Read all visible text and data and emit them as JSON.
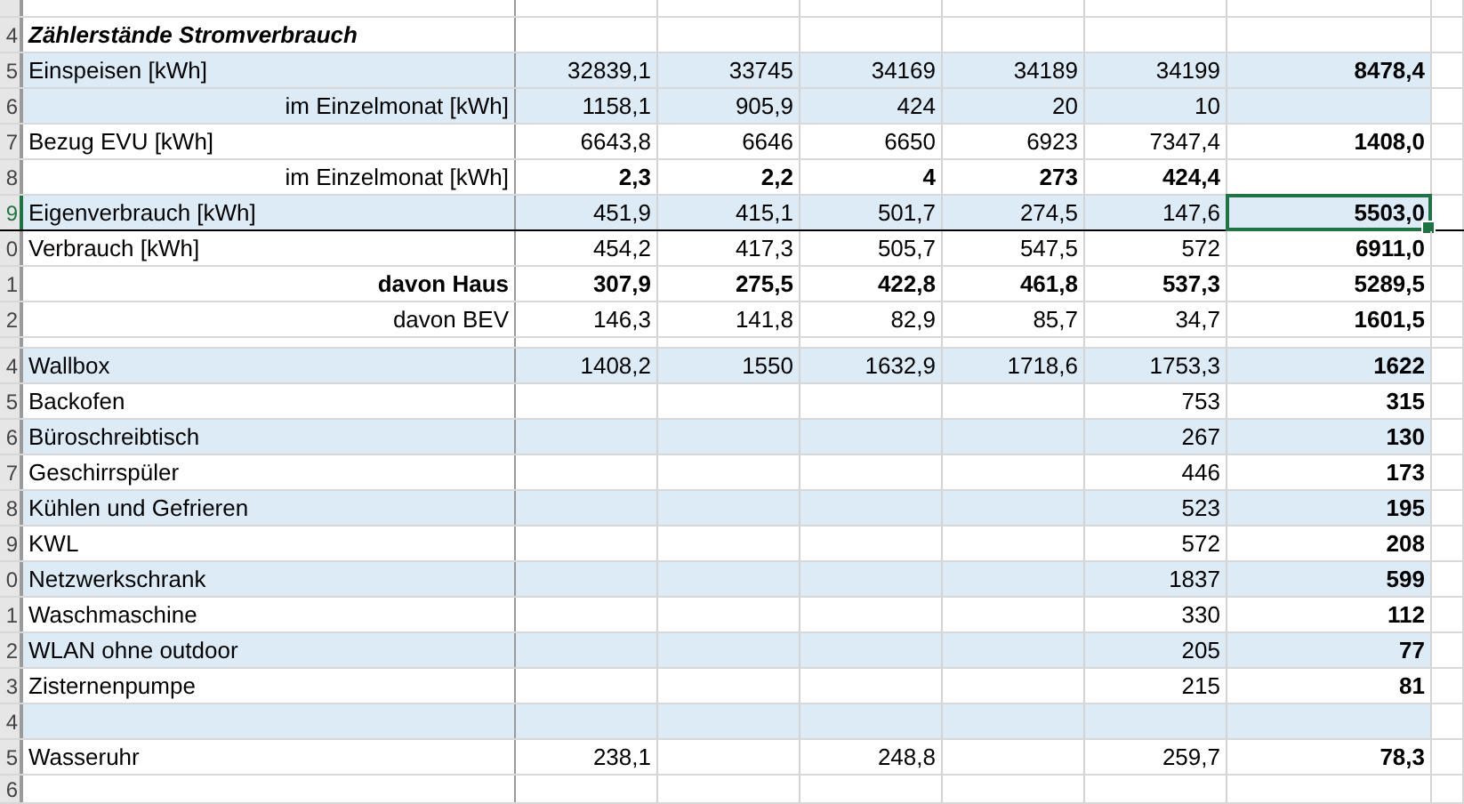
{
  "rows": [
    {
      "kind": "partial"
    },
    {
      "kind": "title",
      "header": "4",
      "label": "Zählerstände Stromverbrauch",
      "shaded": false,
      "selected": false,
      "bottom_border": false
    },
    {
      "kind": "item",
      "header": "5",
      "label": "Einspeisen [kWh]",
      "shaded": true,
      "column_2": "32839,1",
      "column_3": "33745",
      "column_4": "34169",
      "column_5": "34189",
      "column_6": "34199",
      "column_7": "8478,4",
      "values_bold": false,
      "selected": false,
      "bottom_border": false
    },
    {
      "kind": "sub",
      "header": "6",
      "label": "im Einzelmonat [kWh]",
      "shaded": true,
      "column_2": "1158,1",
      "column_3": "905,9",
      "column_4": "424",
      "column_5": "20",
      "column_6": "10",
      "values_bold": false,
      "selected": false,
      "bottom_border": false
    },
    {
      "kind": "item",
      "header": "7",
      "label": "Bezug EVU [kWh]",
      "shaded": false,
      "column_2": "6643,8",
      "column_3": "6646",
      "column_4": "6650",
      "column_5": "6923",
      "column_6": "7347,4",
      "column_7": "1408,0",
      "values_bold": false,
      "selected": false,
      "bottom_border": false
    },
    {
      "kind": "sub",
      "header": "8",
      "label": "im Einzelmonat [kWh]",
      "shaded": false,
      "column_2": "2,3",
      "column_3": "2,2",
      "column_4": "4",
      "column_5": "273",
      "column_6": "424,4",
      "values_bold": true,
      "selected": false,
      "bottom_border": false
    },
    {
      "kind": "item",
      "header": "9",
      "label": "Eigenverbrauch [kWh]",
      "shaded": true,
      "column_2": "451,9",
      "column_3": "415,1",
      "column_4": "501,7",
      "column_5": "274,5",
      "column_6": "147,6",
      "column_7": "5503,0",
      "values_bold": false,
      "selected": true,
      "bottom_border": true
    },
    {
      "kind": "item",
      "header": "0",
      "label": "Verbrauch [kWh]",
      "shaded": false,
      "column_2": "454,2",
      "column_3": "417,3",
      "column_4": "505,7",
      "column_5": "547,5",
      "column_6": "572",
      "column_7": "6911,0",
      "values_bold": false,
      "selected": false,
      "bottom_border": false
    },
    {
      "kind": "sub_bold",
      "header": "1",
      "label": "davon Haus",
      "shaded": false,
      "column_2": "307,9",
      "column_3": "275,5",
      "column_4": "422,8",
      "column_5": "461,8",
      "column_6": "537,3",
      "column_7": "5289,5",
      "values_bold": true,
      "selected": false,
      "bottom_border": false
    },
    {
      "kind": "sub",
      "header": "2",
      "label": "davon BEV",
      "shaded": false,
      "column_2": "146,3",
      "column_3": "141,8",
      "column_4": "82,9",
      "column_5": "85,7",
      "column_6": "34,7",
      "column_7": "1601,5",
      "values_bold": false,
      "selected": false,
      "bottom_border": false
    },
    {
      "kind": "spacer"
    },
    {
      "kind": "item",
      "header": "4",
      "label": "Wallbox",
      "shaded": true,
      "column_2": "1408,2",
      "column_3": "1550",
      "column_4": "1632,9",
      "column_5": "1718,6",
      "column_6": "1753,3",
      "column_7": "1622",
      "values_bold": false,
      "selected": false,
      "bottom_border": false
    },
    {
      "kind": "item",
      "header": "5",
      "label": "Backofen",
      "shaded": false,
      "column_6": "753",
      "column_7": "315",
      "values_bold": false,
      "selected": false,
      "bottom_border": false
    },
    {
      "kind": "item",
      "header": "6",
      "label": "Büroschreibtisch",
      "shaded": true,
      "column_6": "267",
      "column_7": "130",
      "values_bold": false,
      "selected": false,
      "bottom_border": false
    },
    {
      "kind": "item",
      "header": "7",
      "label": "Geschirrspüler",
      "shaded": false,
      "column_6": "446",
      "column_7": "173",
      "values_bold": false,
      "selected": false,
      "bottom_border": false
    },
    {
      "kind": "item",
      "header": "8",
      "label": "Kühlen und Gefrieren",
      "shaded": true,
      "column_6": "523",
      "column_7": "195",
      "values_bold": false,
      "selected": false,
      "bottom_border": false
    },
    {
      "kind": "item",
      "header": "9",
      "label": "KWL",
      "shaded": false,
      "column_6": "572",
      "column_7": "208",
      "values_bold": false,
      "selected": false,
      "bottom_border": false
    },
    {
      "kind": "item",
      "header": "0",
      "label": "Netzwerkschrank",
      "shaded": true,
      "column_6": "1837",
      "column_7": "599",
      "values_bold": false,
      "selected": false,
      "bottom_border": false
    },
    {
      "kind": "item",
      "header": "1",
      "label": "Waschmaschine",
      "shaded": false,
      "column_6": "330",
      "column_7": "112",
      "values_bold": false,
      "selected": false,
      "bottom_border": false
    },
    {
      "kind": "item",
      "header": "2",
      "label": "WLAN ohne outdoor",
      "shaded": true,
      "column_6": "205",
      "column_7": "77",
      "values_bold": false,
      "selected": false,
      "bottom_border": false
    },
    {
      "kind": "item",
      "header": "3",
      "label": "Zisternenpumpe",
      "shaded": false,
      "column_6": "215",
      "column_7": "81",
      "values_bold": false,
      "selected": false,
      "bottom_border": false
    },
    {
      "kind": "blank",
      "header": "4",
      "shaded": true
    },
    {
      "kind": "item",
      "header": "5",
      "label": "Wasseruhr",
      "shaded": false,
      "column_2": "238,1",
      "column_4": "248,8",
      "column_6": "259,7",
      "column_7": "78,3",
      "values_bold": false,
      "selected": false,
      "bottom_border": false
    },
    {
      "kind": "blank",
      "header": "6",
      "shaded": false
    }
  ]
}
